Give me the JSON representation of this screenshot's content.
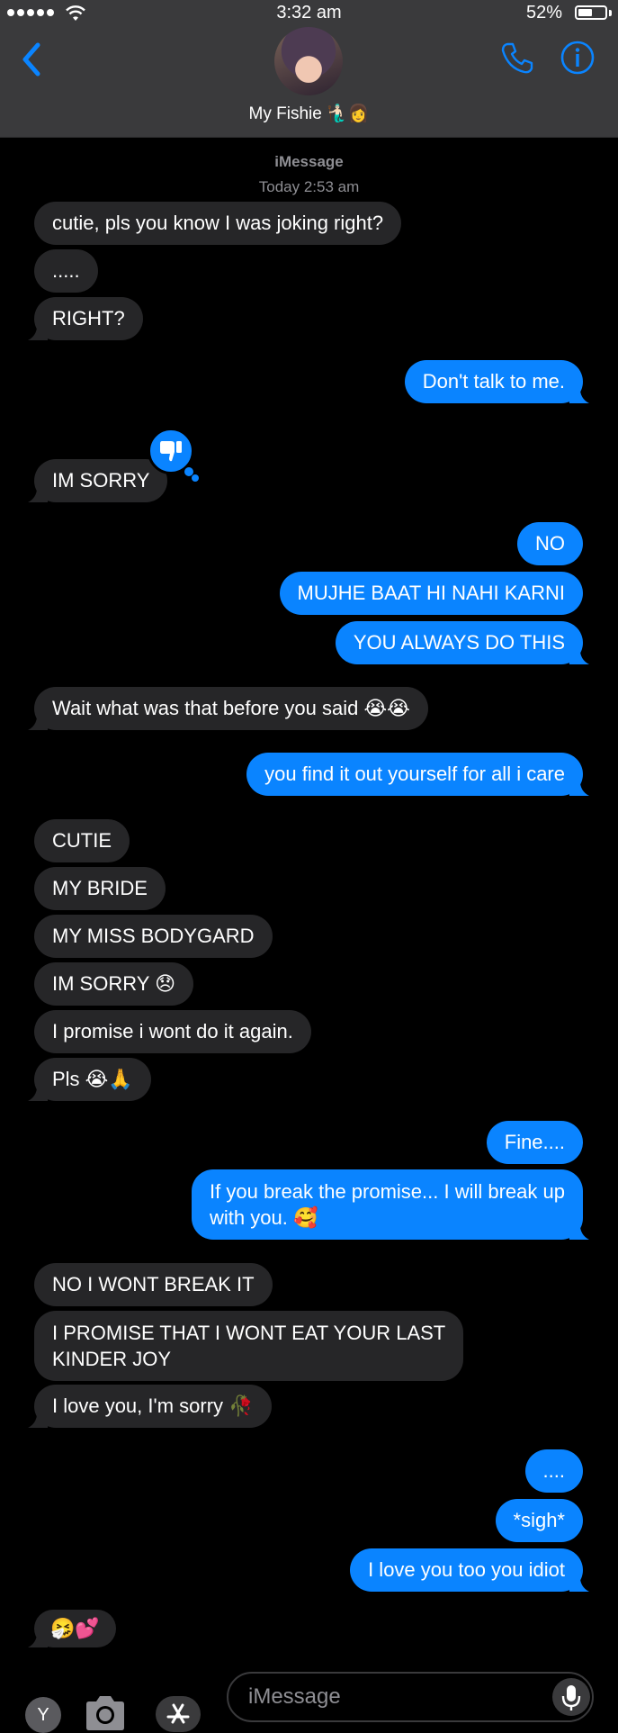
{
  "status_bar": {
    "time": "3:32 am",
    "battery_percent": "52%",
    "battery_level": 0.52
  },
  "header": {
    "contact_name": "My Fishie 🧜🏻‍♂️👩"
  },
  "conversation": {
    "service": "iMessage",
    "timestamp": "Today 2:53 am"
  },
  "messages": [
    {
      "dir": "in",
      "text": "cutie, pls you know I was joking right?"
    },
    {
      "dir": "in",
      "text": "....."
    },
    {
      "dir": "in",
      "text": "RIGHT?"
    },
    {
      "dir": "out",
      "text": "Don't talk to me."
    },
    {
      "dir": "in",
      "text": "IM SORRY",
      "tapback": "thumbs-down"
    },
    {
      "dir": "out",
      "text": "NO"
    },
    {
      "dir": "out",
      "text": "MUJHE BAAT HI NAHI KARNI"
    },
    {
      "dir": "out",
      "text": "YOU ALWAYS DO THIS"
    },
    {
      "dir": "in",
      "text": "Wait what was that before you said 😭😭"
    },
    {
      "dir": "out",
      "text": "you find it out yourself for all i care"
    },
    {
      "dir": "in",
      "text": "CUTIE"
    },
    {
      "dir": "in",
      "text": "MY BRIDE"
    },
    {
      "dir": "in",
      "text": "MY MISS BODYGARD"
    },
    {
      "dir": "in",
      "text": "IM SORRY 😞"
    },
    {
      "dir": "in",
      "text": "I promise i wont do it again."
    },
    {
      "dir": "in",
      "text": "Pls 😭🙏"
    },
    {
      "dir": "out",
      "text": "Fine...."
    },
    {
      "dir": "out",
      "line1": "If you break the promise... I will break up",
      "line2": "with you. 🥰"
    },
    {
      "dir": "in",
      "text": "NO I WONT BREAK IT"
    },
    {
      "dir": "in",
      "line1": "I PROMISE THAT I WONT EAT YOUR LAST",
      "line2": "KINDER JOY"
    },
    {
      "dir": "in",
      "text": "I love you, I'm sorry 🥀"
    },
    {
      "dir": "out",
      "text": "...."
    },
    {
      "dir": "out",
      "text": "*sigh*"
    },
    {
      "dir": "out",
      "text": "I love you too you idiot"
    },
    {
      "dir": "in",
      "text": "🤧💕"
    }
  ],
  "compose": {
    "app_label": "Y",
    "placeholder": "iMessage"
  },
  "colors": {
    "sent_bubble": "#0a84ff",
    "received_bubble": "#262628",
    "header_bg": "#3a3a3c",
    "background": "#000000"
  },
  "icons": [
    "back-chevron-icon",
    "phone-icon",
    "info-icon",
    "thumbs-down-icon",
    "camera-icon",
    "app-store-icon",
    "microphone-icon"
  ]
}
